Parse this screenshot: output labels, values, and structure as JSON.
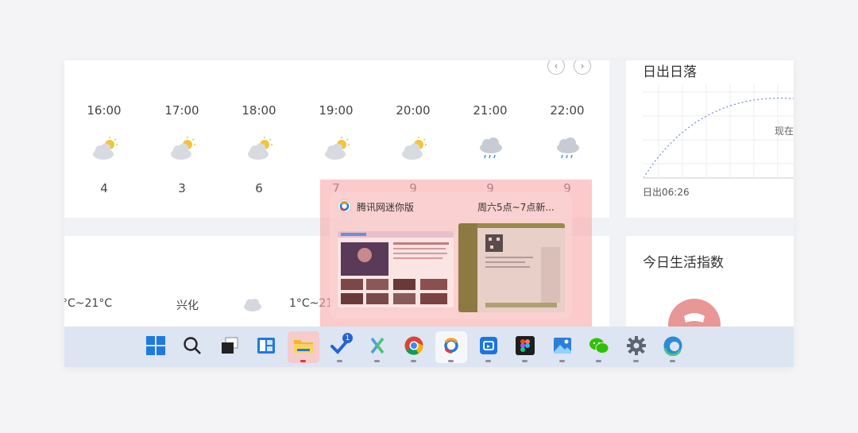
{
  "hourly": {
    "nav_prev": "‹",
    "nav_next": "›",
    "hours": [
      {
        "time": "16:00",
        "temp": "4",
        "icon": "partly-cloudy-icon"
      },
      {
        "time": "17:00",
        "temp": "3",
        "icon": "partly-cloudy-icon"
      },
      {
        "time": "18:00",
        "temp": "6",
        "icon": "partly-cloudy-icon"
      },
      {
        "time": "19:00",
        "temp": "7",
        "icon": "partly-cloudy-icon"
      },
      {
        "time": "20:00",
        "temp": "9",
        "icon": "partly-cloudy-icon"
      },
      {
        "time": "21:00",
        "temp": "9",
        "icon": "rain-cloud-icon"
      },
      {
        "time": "22:00",
        "temp": "9",
        "icon": "rain-cloud-icon"
      }
    ]
  },
  "sun": {
    "title": "日出日落",
    "now_label": "现在",
    "sunrise": "日出06:26"
  },
  "life": {
    "title": "今日生活指数"
  },
  "daily": {
    "range1": "°C~21°C",
    "city": "兴化",
    "range2": "1°C~21"
  },
  "taskbar_preview": {
    "window1_title": "腾讯网迷你版",
    "window2_title": "周六5点~7点新..."
  },
  "taskbar": {
    "apps": [
      {
        "name": "start-button",
        "icon": "windows-logo-icon"
      },
      {
        "name": "search-button",
        "icon": "search-icon"
      },
      {
        "name": "task-view-button",
        "icon": "task-view-icon"
      },
      {
        "name": "widgets-button",
        "icon": "widgets-icon"
      },
      {
        "name": "file-explorer-button",
        "icon": "folder-icon"
      },
      {
        "name": "todo-button",
        "icon": "check-icon",
        "badge": "1"
      },
      {
        "name": "xmind-button",
        "icon": "xmind-icon"
      },
      {
        "name": "chrome-button",
        "icon": "chrome-icon"
      },
      {
        "name": "tencent-news-button",
        "icon": "tencent-news-icon"
      },
      {
        "name": "bilibili-button",
        "icon": "bilibili-icon"
      },
      {
        "name": "figma-button",
        "icon": "figma-icon"
      },
      {
        "name": "photos-button",
        "icon": "photos-icon"
      },
      {
        "name": "wechat-button",
        "icon": "wechat-icon"
      },
      {
        "name": "settings-button",
        "icon": "gear-icon"
      },
      {
        "name": "edge-button",
        "icon": "edge-icon"
      }
    ]
  },
  "colors": {
    "accent_blue": "#1f7ae0",
    "highlight_red": "#f9aaaa",
    "taskbar_bg": "#dde4f2"
  }
}
